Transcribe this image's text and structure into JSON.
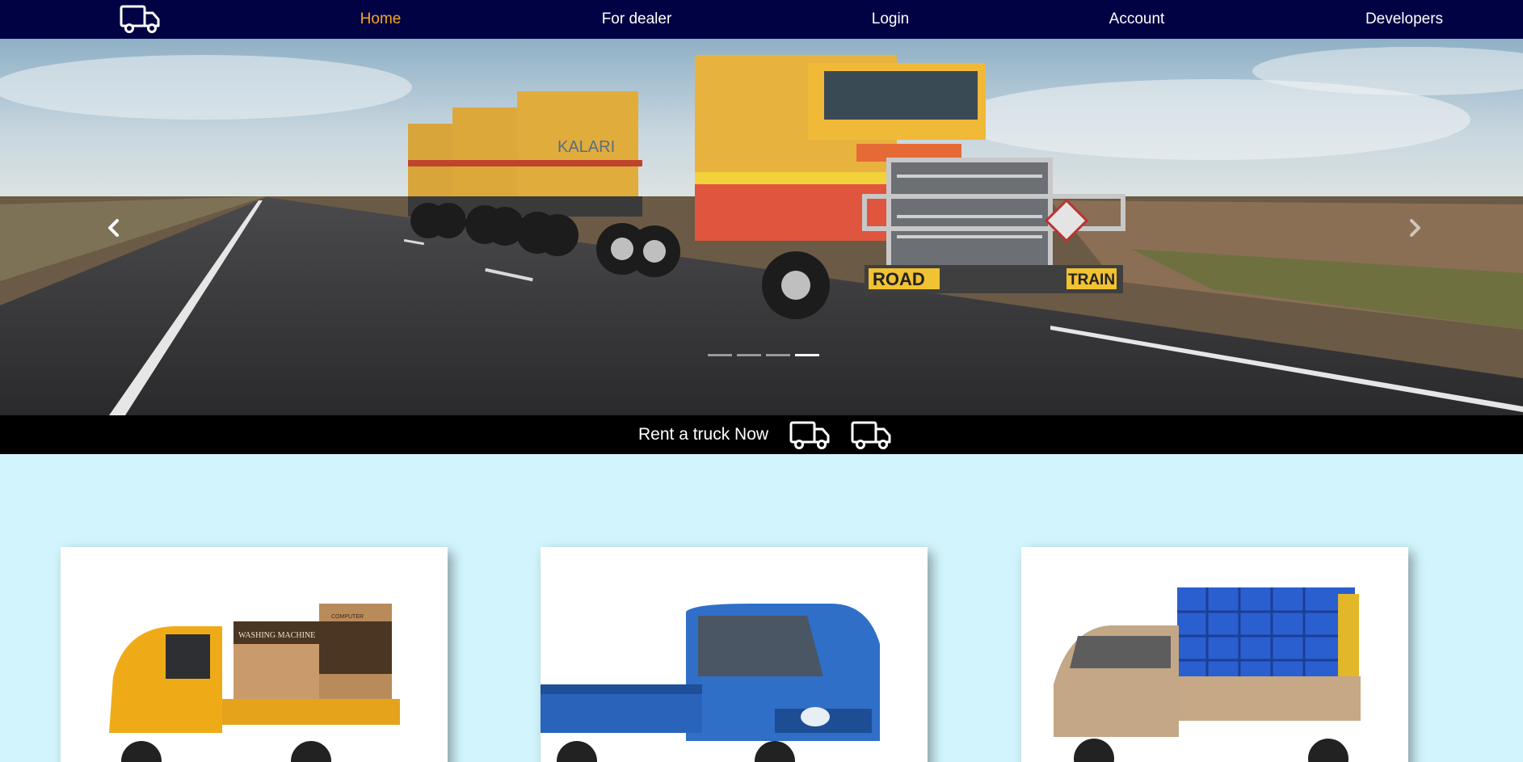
{
  "navbar": {
    "brand_icon": "truck-icon",
    "links": [
      {
        "label": "Home",
        "active": true
      },
      {
        "label": "For dealer",
        "active": false
      },
      {
        "label": "Login",
        "active": false
      },
      {
        "label": "Account",
        "active": false
      },
      {
        "label": "Developers",
        "active": false
      }
    ]
  },
  "hero": {
    "prev_icon": "chevron-left-icon",
    "next_icon": "chevron-right-icon",
    "slide_count": 4,
    "active_slide": 4,
    "plate_left": "ROAD",
    "plate_right": "TRAIN",
    "trailer_text": "KALARI"
  },
  "rent_bar": {
    "label": "Rent a truck Now",
    "icons": [
      "truck-icon",
      "truck-icon"
    ]
  },
  "cards": [
    {
      "name": "three-wheeler-cargo",
      "box_label_1": "WASHING MACHINE",
      "box_label_2": "COMPUTER"
    },
    {
      "name": "blue-pickup"
    },
    {
      "name": "beige-pickup-with-crates"
    }
  ],
  "colors": {
    "nav_bg": "#010244",
    "nav_active": "#f6a623",
    "page_bg": "#d2f5fd",
    "rent_bar_bg": "#000000"
  }
}
